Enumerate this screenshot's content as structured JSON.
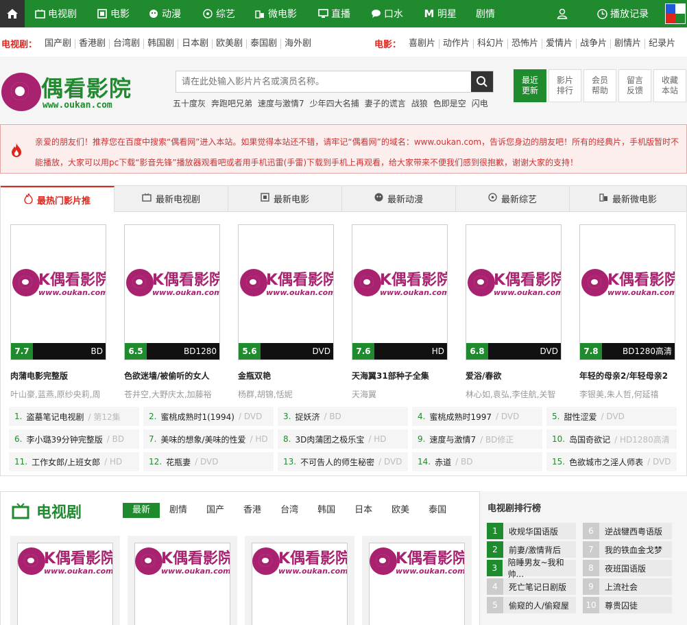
{
  "nav": {
    "items": [
      {
        "label": "电视剧",
        "icon": "tv-icon"
      },
      {
        "label": "电影",
        "icon": "film-icon"
      },
      {
        "label": "动漫",
        "icon": "anime-icon"
      },
      {
        "label": "综艺",
        "icon": "variety-icon"
      },
      {
        "label": "微电影",
        "icon": "micro-film-icon"
      },
      {
        "label": "直播",
        "icon": "monitor-icon"
      },
      {
        "label": "口水",
        "icon": "chat-icon"
      },
      {
        "label": "明星",
        "icon": "star-m-icon"
      },
      {
        "label": "剧情",
        "icon": ""
      }
    ],
    "history": "播放记录"
  },
  "catbar": {
    "tv_head": "电视剧：",
    "tv_links": [
      "国产剧",
      "香港剧",
      "台湾剧",
      "韩国剧",
      "日本剧",
      "欧美剧",
      "泰国剧",
      "海外剧"
    ],
    "movie_head": "电影：",
    "movie_links": [
      "喜剧片",
      "动作片",
      "科幻片",
      "恐怖片",
      "爱情片",
      "战争片",
      "剧情片",
      "纪录片"
    ]
  },
  "header": {
    "logo_name": "偶看影院",
    "logo_url": "www.oukan.com",
    "search_placeholder": "请在此处输入影片片名或演员名称。",
    "hotwords": [
      "五十度灰",
      "奔跑吧兄弟",
      "速度与激情7",
      "少年四大名捕",
      "妻子的谎言",
      "战狼",
      "色即是空",
      "闪电"
    ],
    "quick": [
      {
        "line1": "最近",
        "line2": "更新"
      },
      {
        "line1": "影片",
        "line2": "排行"
      },
      {
        "line1": "会员",
        "line2": "帮助"
      },
      {
        "line1": "留言",
        "line2": "反馈"
      },
      {
        "line1": "收藏",
        "line2": "本站"
      }
    ]
  },
  "notice": {
    "text": "亲爱的朋友们！推荐您在百度中搜索“偶看网”进入本站。如果觉得本站还不错，请牢记“偶看网”的域名：www.oukan.com，告诉您身边的朋友吧！所有的经典片，手机版暂时不能播放，大家可以用pc下载“影音先锋”播放器观看吧或者用手机迅雷(手雷)下载到手机上再观看，给大家带来不便我们感到很抱歉，谢谢大家的支持！"
  },
  "tabs": [
    "最热门影片推",
    "最新电视剧",
    "最新电影",
    "最新动漫",
    "最新综艺",
    "最新微电影"
  ],
  "poster_logo": {
    "text": "K偶看影院",
    "url": "www.oukan.com"
  },
  "cards": [
    {
      "score": "7.7",
      "quality": "BD",
      "title": "肉蒲电影完整版",
      "actors": "叶山豪,蓝燕,原纱央莉,周"
    },
    {
      "score": "6.5",
      "quality": "BD1280",
      "title": "色欲迷墙/被偷听的女人",
      "actors": "苍井空,大野庆太,加藤裕"
    },
    {
      "score": "5.6",
      "quality": "DVD",
      "title": "金瓶双艳",
      "actors": "杨群,胡锦,恬妮"
    },
    {
      "score": "7.6",
      "quality": "HD",
      "title": "天海翼31部种子全集",
      "actors": "天海翼"
    },
    {
      "score": "6.8",
      "quality": "DVD",
      "title": "爱浴/春欲",
      "actors": "林心如,袁弘,李佳航,关智"
    },
    {
      "score": "7.8",
      "quality": "BD1280高清",
      "title": "年轻的母亲2/年轻母亲2",
      "actors": "李银美,朱人哲,何延禧"
    }
  ],
  "ranklist": [
    {
      "num": "1.",
      "name": "盗墓笔记电视剧",
      "q": "/ 第12集"
    },
    {
      "num": "2.",
      "name": "蜜桃成熟时1(1994)",
      "q": "/ DVD"
    },
    {
      "num": "3.",
      "name": "捉妖济",
      "q": "/ BD"
    },
    {
      "num": "4.",
      "name": "蜜桃成熟时1997",
      "q": "/ DVD"
    },
    {
      "num": "5.",
      "name": "甜性涩爱",
      "q": "/ DVD"
    },
    {
      "num": "6.",
      "name": "李小璐39分钟完整版",
      "q": "/ BD"
    },
    {
      "num": "7.",
      "name": "美味的想象/美味的性爱",
      "q": "/ HD"
    },
    {
      "num": "8.",
      "name": "3D肉蒲团之极乐宝",
      "q": "/ HD"
    },
    {
      "num": "9.",
      "name": "速度与激情7",
      "q": "/ BD修正"
    },
    {
      "num": "10.",
      "name": "岛国奇欲记",
      "q": "/ HD1280高清"
    },
    {
      "num": "11.",
      "name": "工作女郎/上班女郎",
      "q": "/ HD"
    },
    {
      "num": "12.",
      "name": "花瓶妻",
      "q": "/ DVD"
    },
    {
      "num": "13.",
      "name": "不可告人的师生秘密",
      "q": "/ DVD"
    },
    {
      "num": "14.",
      "name": "赤道",
      "q": "/ BD"
    },
    {
      "num": "15.",
      "name": "色欲城市之淫人师表",
      "q": "/ DVD"
    }
  ],
  "tv_section": {
    "title": "电视剧",
    "tabs": [
      "最新",
      "剧情",
      "国产",
      "香港",
      "台湾",
      "韩国",
      "日本",
      "欧美",
      "泰国"
    ],
    "rank_title": "电视剧排行榜",
    "rank_left": [
      {
        "n": "1",
        "name": "收规华国语版"
      },
      {
        "n": "2",
        "name": "前妻/激情背后"
      },
      {
        "n": "3",
        "name": "陪睡男友~我和帅..."
      },
      {
        "n": "4",
        "name": "死亡笔记日剧版"
      },
      {
        "n": "5",
        "name": "偷窥的人/偷窥屋"
      }
    ],
    "rank_right": [
      {
        "n": "6",
        "name": "逆战犍西粤语版"
      },
      {
        "n": "7",
        "name": "我的铁血金戈梦"
      },
      {
        "n": "8",
        "name": "夜班国语版"
      },
      {
        "n": "9",
        "name": "上流社会"
      },
      {
        "n": "10",
        "name": "尊贵囚徒"
      }
    ]
  },
  "colors": {
    "brand_green": "#1f8a2e",
    "accent_red": "#e0251b",
    "logo_magenta": "#a8226f"
  }
}
